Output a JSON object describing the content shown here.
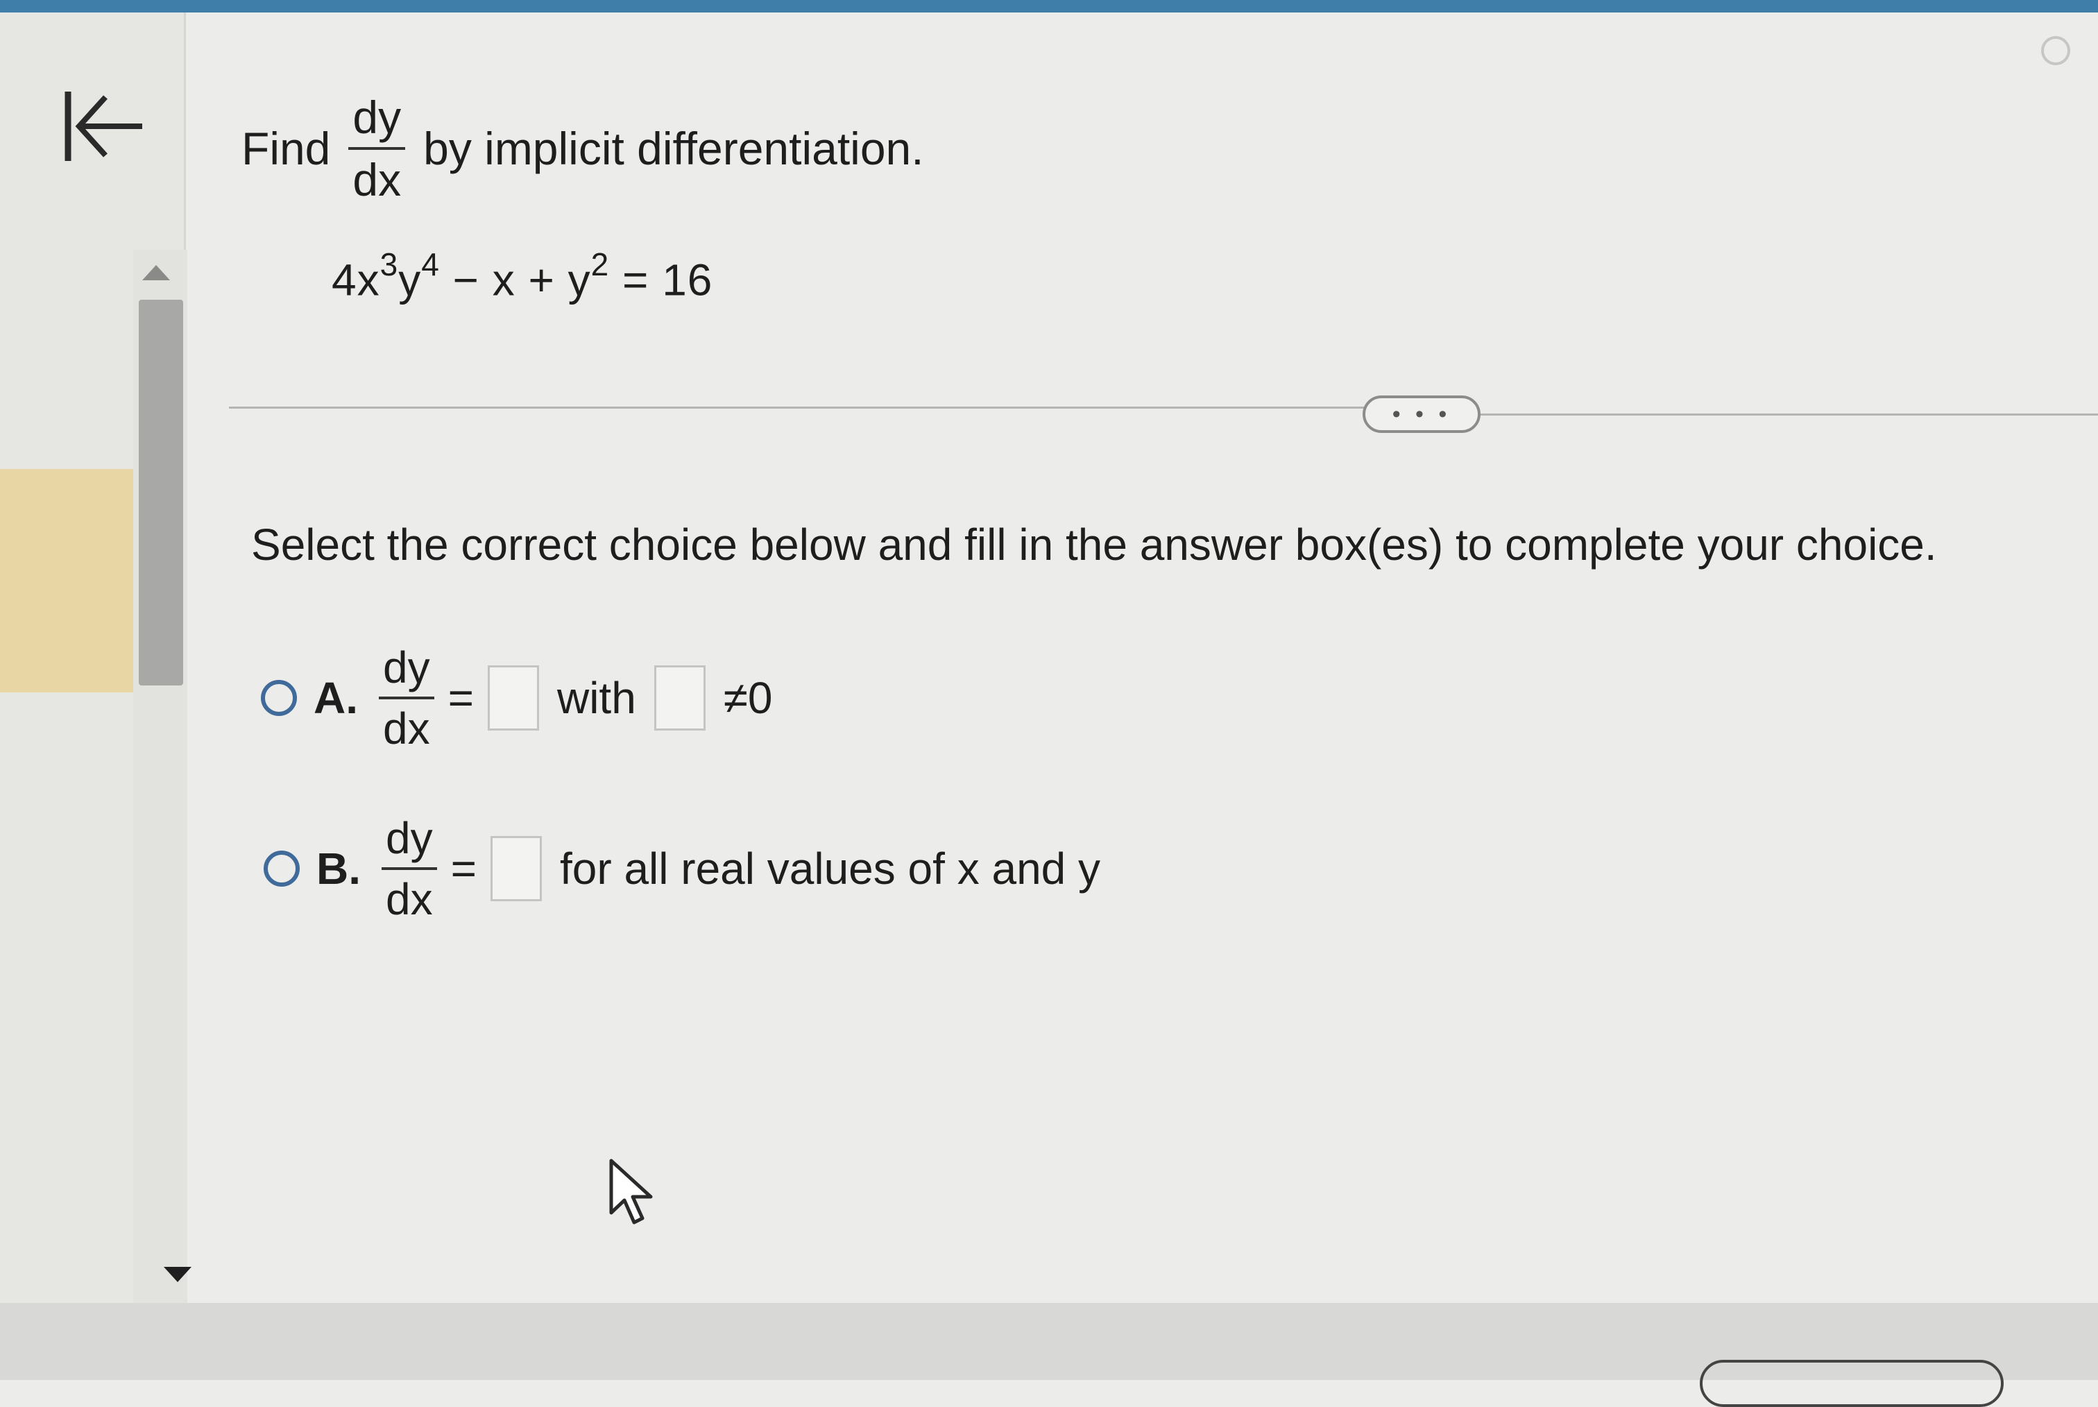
{
  "question": {
    "find_label": "Find",
    "frac_num": "dy",
    "frac_den": "dx",
    "suffix": "by implicit differentiation.",
    "equation": {
      "t1": "4x",
      "s1": "3",
      "t2": "y",
      "s2": "4",
      "t3": " − x + y",
      "s3": "2",
      "t4": " = 16"
    }
  },
  "more_button": "• • •",
  "instruction": "Select the correct choice below and fill in the answer box(es) to complete your choice.",
  "choices": [
    {
      "letter": "A.",
      "num": "dy",
      "den": "dx",
      "equals": "=",
      "with_label": "with",
      "condition": "≠0"
    },
    {
      "letter": "B.",
      "num": "dy",
      "den": "dx",
      "equals": "=",
      "condition": "for all real values of x and y"
    }
  ],
  "colors": {
    "topbar": "#3f7ea8",
    "radio": "#3f6a9a"
  },
  "icons": {
    "back": "back-to-start-icon",
    "cursor": "mouse-pointer-icon"
  }
}
